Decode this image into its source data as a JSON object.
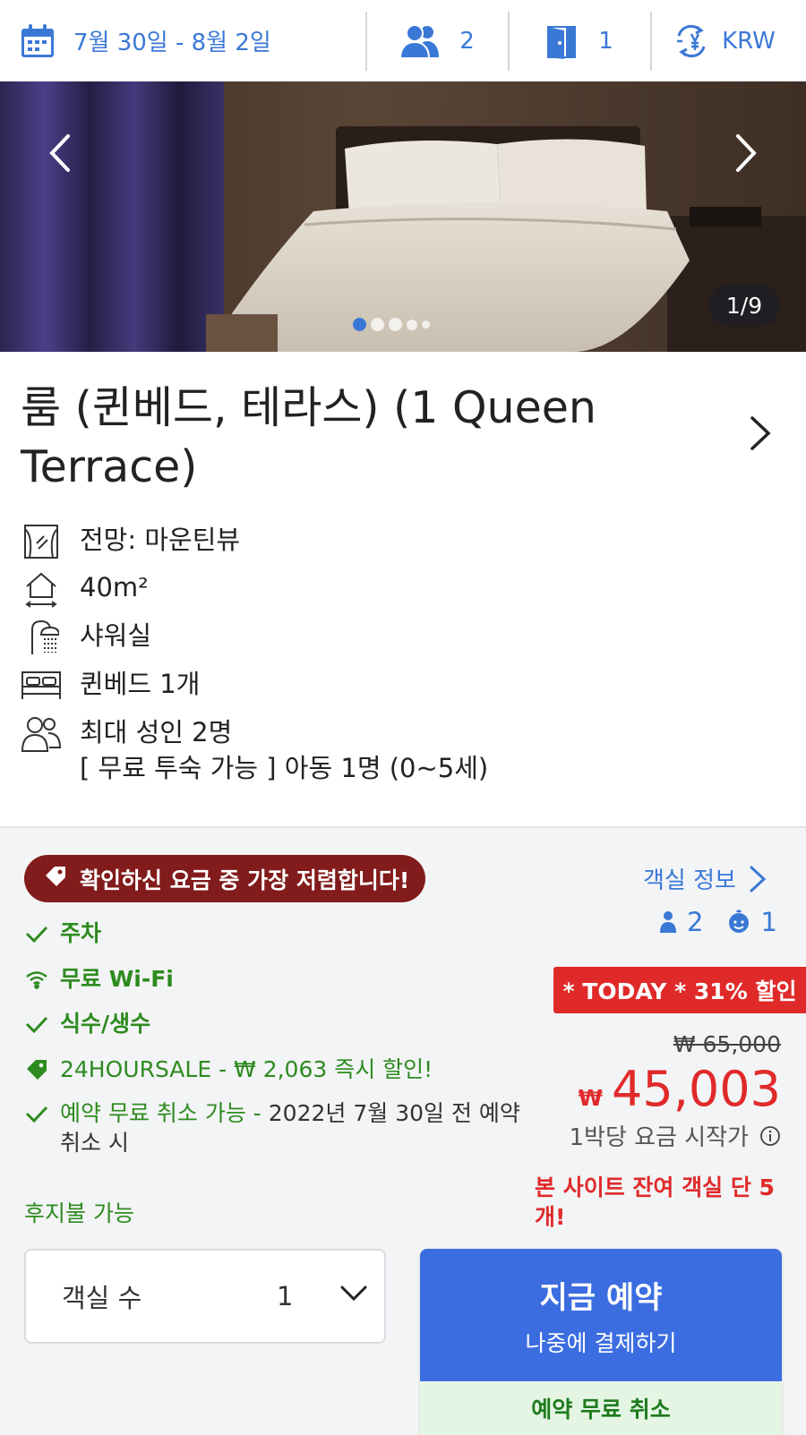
{
  "search_bar": {
    "dates": "7월 30일 - 8월 2일",
    "guests": "2",
    "rooms": "1",
    "currency": "KRW"
  },
  "gallery": {
    "counter": "1/9",
    "current_index": 1,
    "total": 9
  },
  "room": {
    "title": "룸 (퀸베드, 테라스) (1 Queen Terrace)",
    "features": [
      {
        "icon": "window-view-icon",
        "text": "전망: 마운틴뷰"
      },
      {
        "icon": "area-icon",
        "text": "40m²"
      },
      {
        "icon": "shower-icon",
        "text": "샤워실"
      },
      {
        "icon": "bed-icon",
        "text": "퀸베드 1개"
      },
      {
        "icon": "people-icon",
        "text": "최대 성인 2명",
        "text2": "[ 무료 투숙 가능 ] 아동 1명 (0~5세)"
      }
    ]
  },
  "rate": {
    "cheapest_badge": "확인하신 요금 중 가장 저렴합니다!",
    "amenities": {
      "parking": "주차",
      "wifi": "무료 Wi-Fi",
      "water": "식수/생수",
      "promo": "24HOURSALE - ₩ 2,063 즉시 할인!",
      "cancel_green": "예약 무료 취소 가능 - ",
      "cancel_grey": "2022년 7월 30일 전 예약 취소 시"
    },
    "postpay": "후지불 가능",
    "room_info_link": "객실 정보",
    "adults": "2",
    "children": "1",
    "discount_badge": "* TODAY * 31% 할인",
    "original_price": "₩ 65,000",
    "currency_symbol": "₩",
    "price": "45,003",
    "per_night": "1박당 요금 시작가",
    "rooms_left": "본 사이트 잔여 객실 단 5개!",
    "room_count_label": "객실 수",
    "room_count_value": "1",
    "book_now": "지금 예약",
    "pay_later": "나중에 결제하기",
    "free_cancel": "예약 무료 취소"
  },
  "colors": {
    "link_blue": "#3a78d6",
    "book_blue": "#3c6de0",
    "green": "#2e8b1f",
    "red": "#e02a2a",
    "badge_dark_red": "#821b1b"
  }
}
